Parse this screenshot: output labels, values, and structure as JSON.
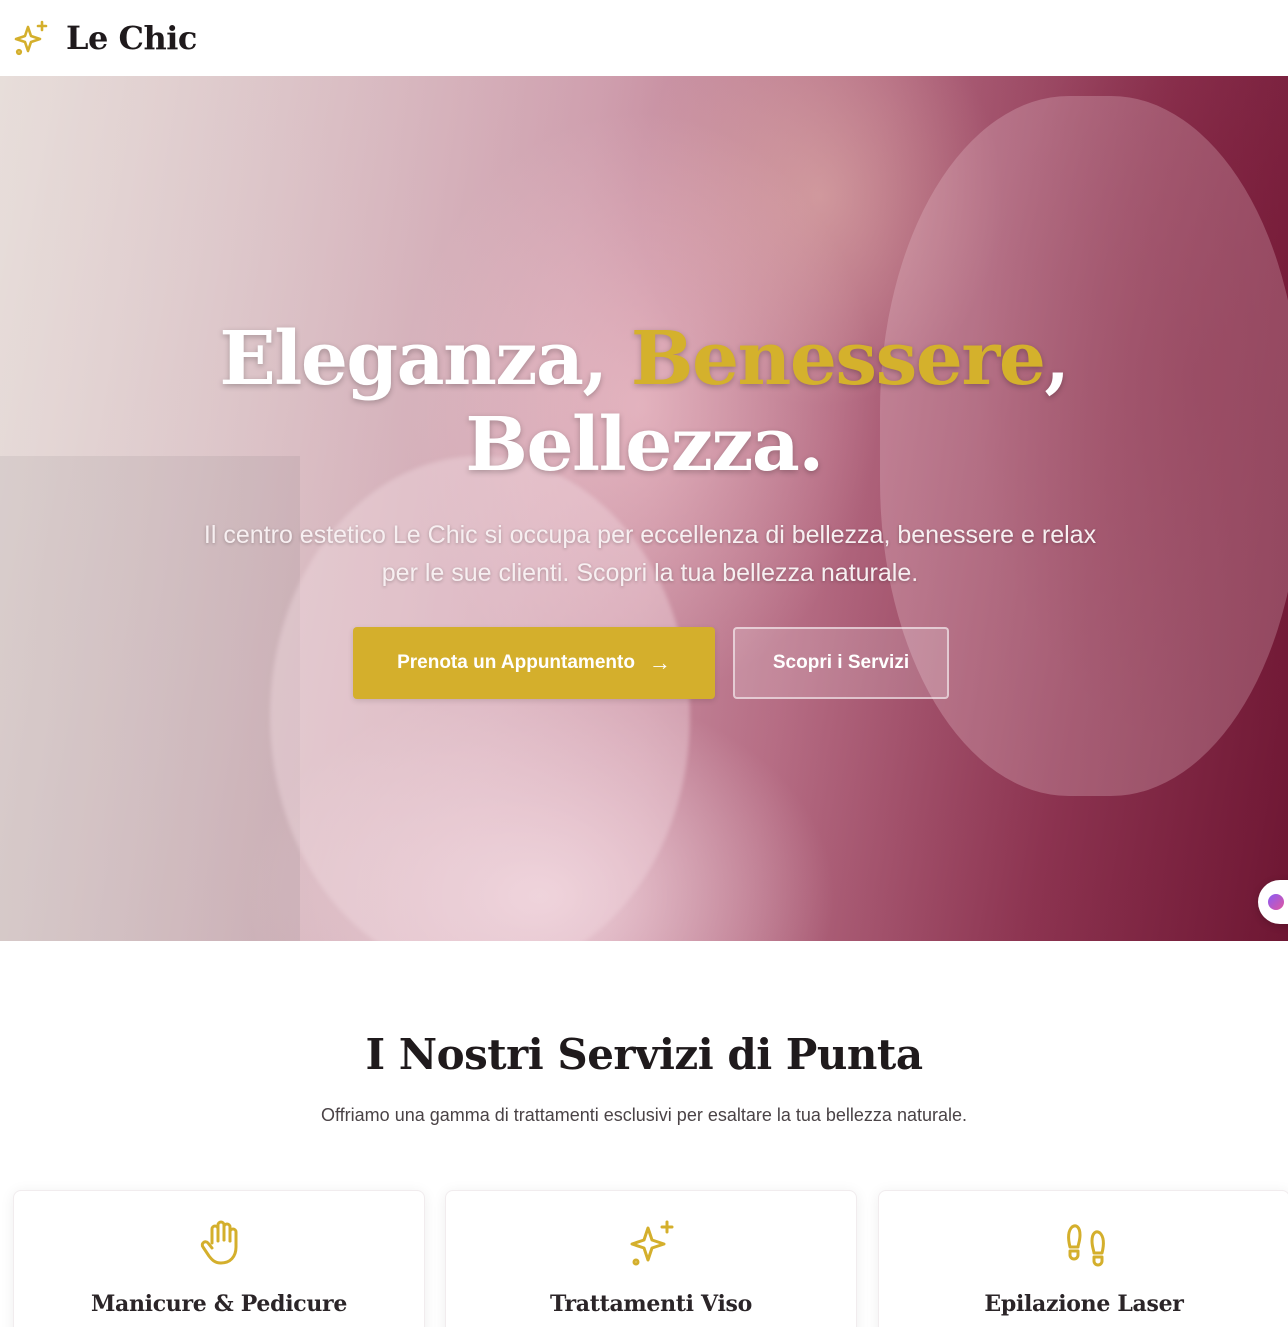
{
  "brand": {
    "name": "Le Chic",
    "logo_icon": "sparkles-icon",
    "accent_color": "#d4af2c",
    "hero_overlay_color": "#8f3552"
  },
  "hero": {
    "title_part1": "Eleganza, ",
    "title_accent": "Benessere",
    "title_part2": ",",
    "title_line2": "Bellezza.",
    "subtitle": "Il centro estetico Le Chic si occupa per eccellenza di bellezza, benessere e relax per le sue clienti. Scopri la tua bellezza naturale.",
    "primary_button": "Prenota un Appuntamento",
    "primary_button_icon": "arrow-right-icon",
    "secondary_button": "Scopri i Servizi"
  },
  "services": {
    "title": "I Nostri Servizi di Punta",
    "subtitle": "Offriamo una gamma di trattamenti esclusivi per esaltare la tua bellezza naturale.",
    "cards": [
      {
        "title": "Manicure & Pedicure",
        "icon": "hand-icon"
      },
      {
        "title": "Trattamenti Viso",
        "icon": "sparkles-icon"
      },
      {
        "title": "Epilazione Laser",
        "icon": "footprints-icon"
      }
    ]
  },
  "widget": {
    "icon": "chat-widget-icon"
  }
}
